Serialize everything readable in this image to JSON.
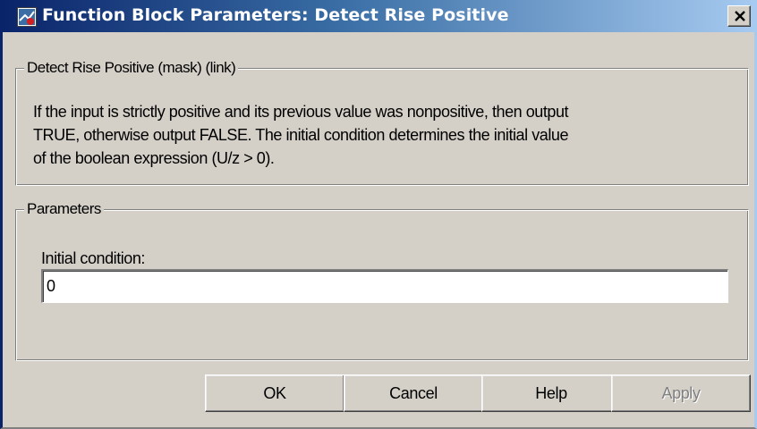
{
  "window": {
    "title": "Function Block Parameters: Detect Rise Positive",
    "icon": "simulink-block-icon",
    "close_label": "close-icon"
  },
  "description_group": {
    "legend": "Detect Rise Positive (mask) (link)",
    "lines": [
      "If the input is strictly positive and its previous value was nonpositive, then output",
      "TRUE, otherwise output FALSE.  The initial condition determines the initial value",
      "of the boolean expression (U/z > 0)."
    ]
  },
  "parameters_group": {
    "legend": "Parameters",
    "initial_condition_label": "Initial condition:",
    "initial_condition_value": "0"
  },
  "buttons": {
    "ok": "OK",
    "cancel": "Cancel",
    "help": "Help",
    "apply": "Apply"
  },
  "colors": {
    "title_start": "#0a246a",
    "title_end": "#a6caf0",
    "face": "#d4d0c8"
  }
}
